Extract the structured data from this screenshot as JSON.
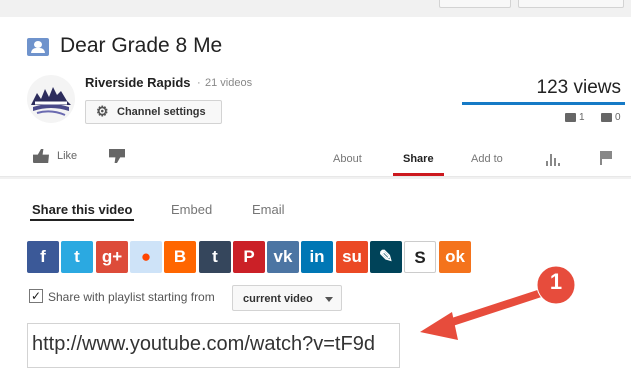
{
  "video": {
    "title": "Dear Grade 8 Me",
    "views": "123 views",
    "likes": "1",
    "dislikes": "0"
  },
  "channel": {
    "name": "Riverside Rapids",
    "separator": "·",
    "video_count": "21 videos",
    "settings_label": "Channel settings"
  },
  "actions": {
    "like_label": "Like"
  },
  "tabs": [
    {
      "label": "About"
    },
    {
      "label": "Share"
    },
    {
      "label": "Add to"
    }
  ],
  "share": {
    "subtabs": [
      {
        "label": "Share this video"
      },
      {
        "label": "Embed"
      },
      {
        "label": "Email"
      }
    ],
    "services": [
      {
        "name": "facebook",
        "glyph": "f",
        "color": "#3b5998"
      },
      {
        "name": "twitter",
        "glyph": "t",
        "color": "#2ba9e1"
      },
      {
        "name": "google-plus",
        "glyph": "g+",
        "color": "#dd4b39"
      },
      {
        "name": "reddit",
        "glyph": "",
        "color": "#cee3f8"
      },
      {
        "name": "blogger",
        "glyph": "B",
        "color": "#ff6600"
      },
      {
        "name": "tumblr",
        "glyph": "t",
        "color": "#35465c"
      },
      {
        "name": "pinterest",
        "glyph": "P",
        "color": "#cb2027"
      },
      {
        "name": "vk",
        "glyph": "vk",
        "color": "#4c75a3"
      },
      {
        "name": "linkedin",
        "glyph": "in",
        "color": "#0077b5"
      },
      {
        "name": "stumbleupon",
        "glyph": "su",
        "color": "#eb4924"
      },
      {
        "name": "livejournal",
        "glyph": "",
        "color": "#004359"
      },
      {
        "name": "myspace",
        "glyph": "S",
        "color": "#ffffff"
      },
      {
        "name": "odnoklassniki",
        "glyph": "ok",
        "color": "#f4731c"
      }
    ],
    "playlist_checkbox_checked": true,
    "playlist_label": "Share with playlist starting from",
    "playlist_option": "current video",
    "url": "http://www.youtube.com/watch?v=tF9d"
  },
  "annotation": {
    "step_number": "1",
    "color": "#e74c3c"
  }
}
